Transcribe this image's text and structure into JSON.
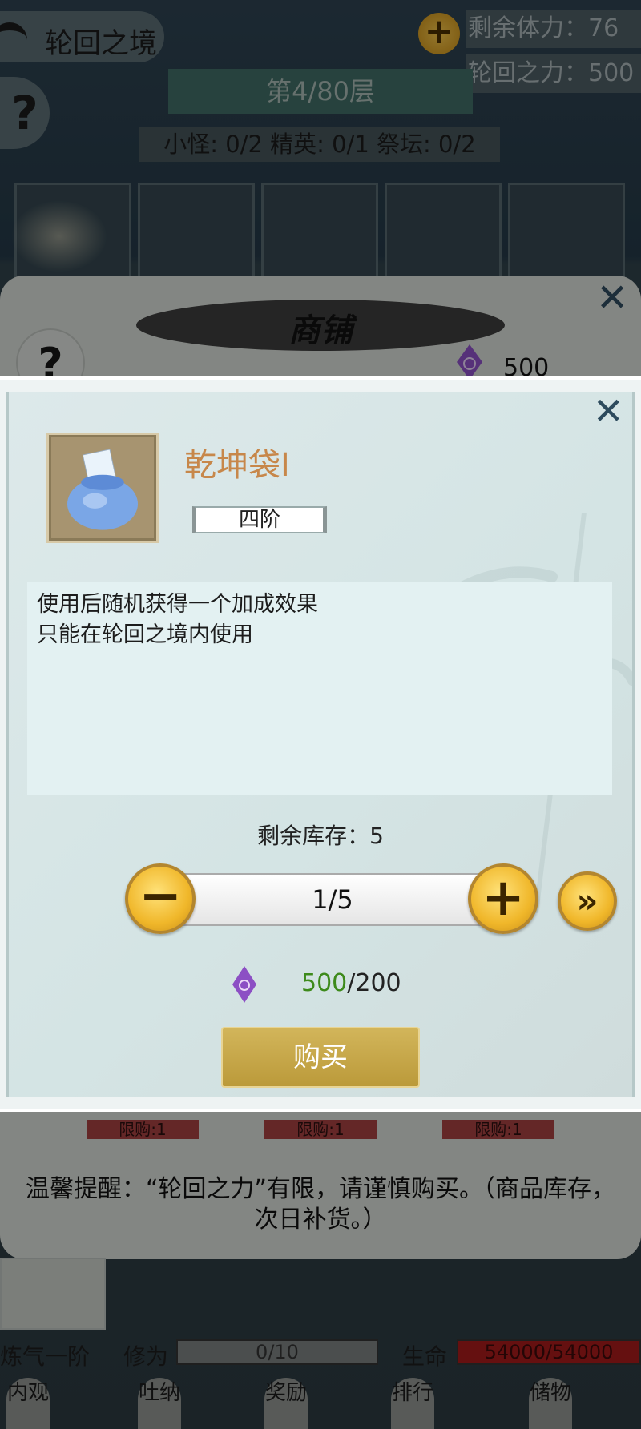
{
  "header": {
    "area_title": "轮回之境",
    "stamina": "剩余体力：76",
    "reincarnation_power": "轮回之力：500",
    "floor": "第4/80层",
    "counts": "小怪: 0/2 精英: 0/1 祭坛: 0/2"
  },
  "shop": {
    "title": "商铺",
    "currency_amount": "500",
    "limit_labels": [
      "限购:1",
      "限购:1",
      "限购:1"
    ],
    "tip": "温馨提醒：“轮回之力”有限，请谨慎购买。（商品库存，次日补货。）"
  },
  "player": {
    "realm": "炼气一阶",
    "xiuwei_label": "修为",
    "xiuwei_value": "0/10",
    "hp_label": "生命",
    "hp_value": "54000/54000"
  },
  "nav": [
    "内观",
    "吐纳",
    "奖励",
    "排行",
    "储物"
  ],
  "item": {
    "name": "乾坤袋I",
    "tier": "四阶",
    "description_lines": [
      "使用后随机获得一个加成效果",
      "只能在轮回之境内使用"
    ],
    "stock": "剩余库存：5",
    "quantity": "1/5",
    "price_have": "500",
    "price_cost": "/200",
    "buy_label": "购买"
  },
  "icons": {
    "plus": "plus-icon",
    "minus": "minus-icon",
    "max": "double-chevron-right-icon",
    "close": "close-icon",
    "currency": "purple-gem-icon",
    "help": "question-icon",
    "item": "blue-pouch-icon"
  },
  "colors": {
    "item_name": "#c7874a",
    "price_have": "#3d8a1b",
    "buy_button": "#c4a548",
    "gold_button": "#f0b72a",
    "currency_gem": "#8c4fc4"
  }
}
